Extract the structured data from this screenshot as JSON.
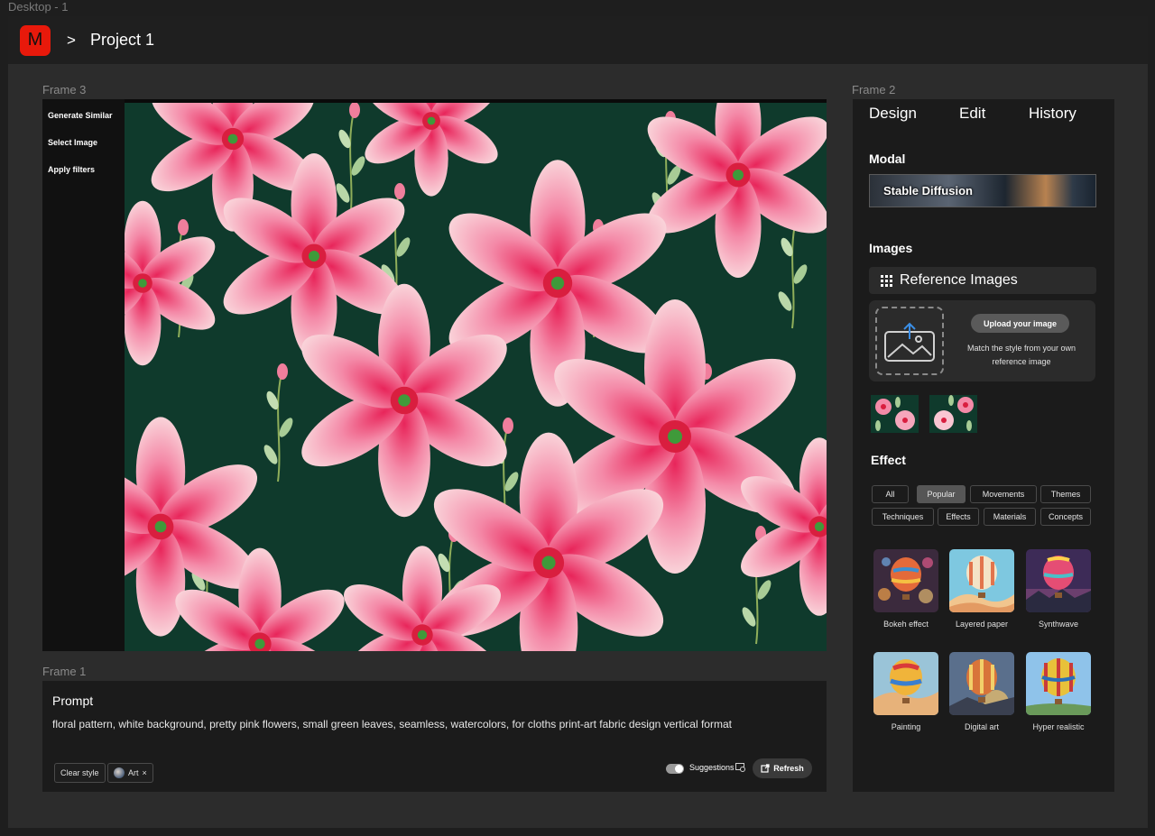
{
  "desktop_label": "Desktop - 1",
  "app": {
    "logo_letter": "M",
    "breadcrumb_separator": ">",
    "project_title": "Project 1",
    "brand_color": "#e8190b"
  },
  "frames": {
    "frame3_label": "Frame 3",
    "frame2_label": "Frame 2",
    "frame1_label": "Frame 1"
  },
  "side_actions": [
    "Generate Similar",
    "Select Image",
    "Apply filters"
  ],
  "prompt": {
    "title": "Prompt",
    "text": "floral pattern, white background, pretty pink flowers, small green leaves, seamless, watercolors, for cloths print-art fabric design vertical format",
    "clear_style_label": "Clear style",
    "style_chip_label": "Art",
    "style_chip_remove": "×",
    "suggestions_label": "Suggestions",
    "suggestions_on": true,
    "refresh_label": "Refresh"
  },
  "panel": {
    "tabs": [
      "Design",
      "Edit",
      "History"
    ],
    "model_title": "Modal",
    "model_name": "Stable Diffusion",
    "images_title": "Images",
    "reference_header": "Reference Images",
    "upload_button": "Upload your image",
    "upload_description": "Match the style from your own reference image",
    "effect_title": "Effect",
    "filters": [
      "All",
      "Popular",
      "Movements",
      "Themes",
      "Techniques",
      "Effects",
      "Materials",
      "Concepts"
    ],
    "active_filter": "Popular",
    "effects": [
      "Bokeh effect",
      "Layered paper",
      "Synthwave",
      "Painting",
      "Digital art",
      "Hyper realistic"
    ]
  }
}
